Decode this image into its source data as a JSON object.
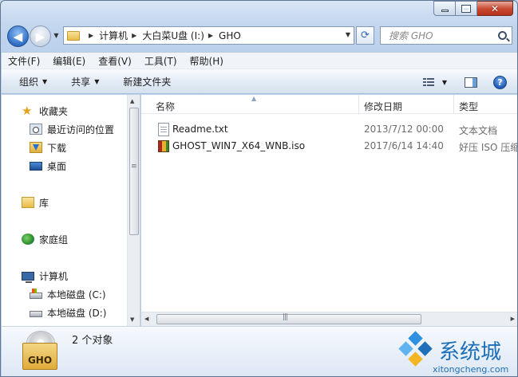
{
  "window": {
    "caption": {
      "minimize": "—",
      "maximize": "□",
      "close": "✕"
    }
  },
  "nav": {
    "breadcrumbs": [
      "计算机",
      "大白菜U盘 (I:)",
      "GHO"
    ],
    "search_placeholder": "搜索 GHO",
    "back_glyph": "◀",
    "forward_glyph": "▶",
    "refresh_glyph": "⟳"
  },
  "menubar": [
    "文件(F)",
    "编辑(E)",
    "查看(V)",
    "工具(T)",
    "帮助(H)"
  ],
  "toolbar": {
    "organize": "组织",
    "share": "共享",
    "new_folder": "新建文件夹",
    "help": "?"
  },
  "navpane": {
    "favorites": "收藏夹",
    "recent": "最近访问的位置",
    "downloads": "下载",
    "desktop": "桌面",
    "libraries": "库",
    "homegroup": "家庭组",
    "computer": "计算机",
    "drive_c": "本地磁盘 (C:)",
    "drive_d": "本地磁盘 (D:)"
  },
  "columns": {
    "name": "名称",
    "modified": "修改日期",
    "type": "类型"
  },
  "files": [
    {
      "name": "Readme.txt",
      "modified": "2013/7/12 00:00",
      "type": "文本文档",
      "icon": "text-file-icon"
    },
    {
      "name": "GHOST_WIN7_X64_WNB.iso",
      "modified": "2017/6/14 14:40",
      "type": "好压 ISO 压缩",
      "icon": "iso-archive-icon"
    }
  ],
  "details": {
    "icon_label": "GHO",
    "count": "2 个对象"
  },
  "watermark": {
    "brand": "系统城",
    "url": "xitongcheng.com"
  },
  "colors": {
    "accent": "#1c6fb8",
    "frame": "#c3d6ee"
  }
}
